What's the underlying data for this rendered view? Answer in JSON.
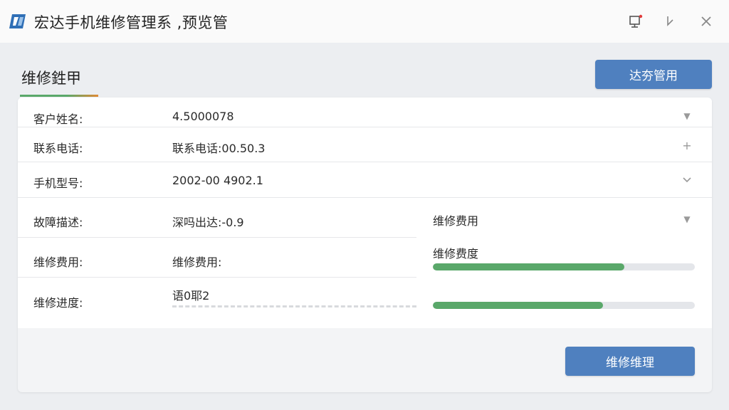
{
  "window": {
    "title": "宏达手机维修管理系 ,预览管",
    "pin_icon": "pin-window-icon",
    "minimize_icon": "minimize-icon",
    "close_icon": "close-icon"
  },
  "page": {
    "heading": "维修鉎甲",
    "top_action_label": "达夯管用"
  },
  "form": {
    "rows": [
      {
        "label": "客户姓名:",
        "value": "4.5000078",
        "control": "dropdown"
      },
      {
        "label": "联系电话:",
        "value": "联系电话:00.50.3",
        "control": "plus"
      },
      {
        "label": "手机型号:",
        "value": "2002-00 4902.1",
        "control": "chevron"
      },
      {
        "label": "故障描述:",
        "value": "深吗出达:-0.9",
        "control": "dropdown"
      },
      {
        "label": "维修费用:",
        "value": "维修费用:"
      },
      {
        "label": "维修进度:",
        "value": "语0耶2"
      }
    ],
    "right_panel": {
      "select_label": "维修费用",
      "progress_label": "维修费度",
      "progress_1": 0.73,
      "progress_2": 0.65
    }
  },
  "footer": {
    "submit_label": "维修维理"
  },
  "colors": {
    "accent_blue": "#4f80bf",
    "progress_green": "#5aa86a",
    "underline_orange": "#e08a35"
  }
}
